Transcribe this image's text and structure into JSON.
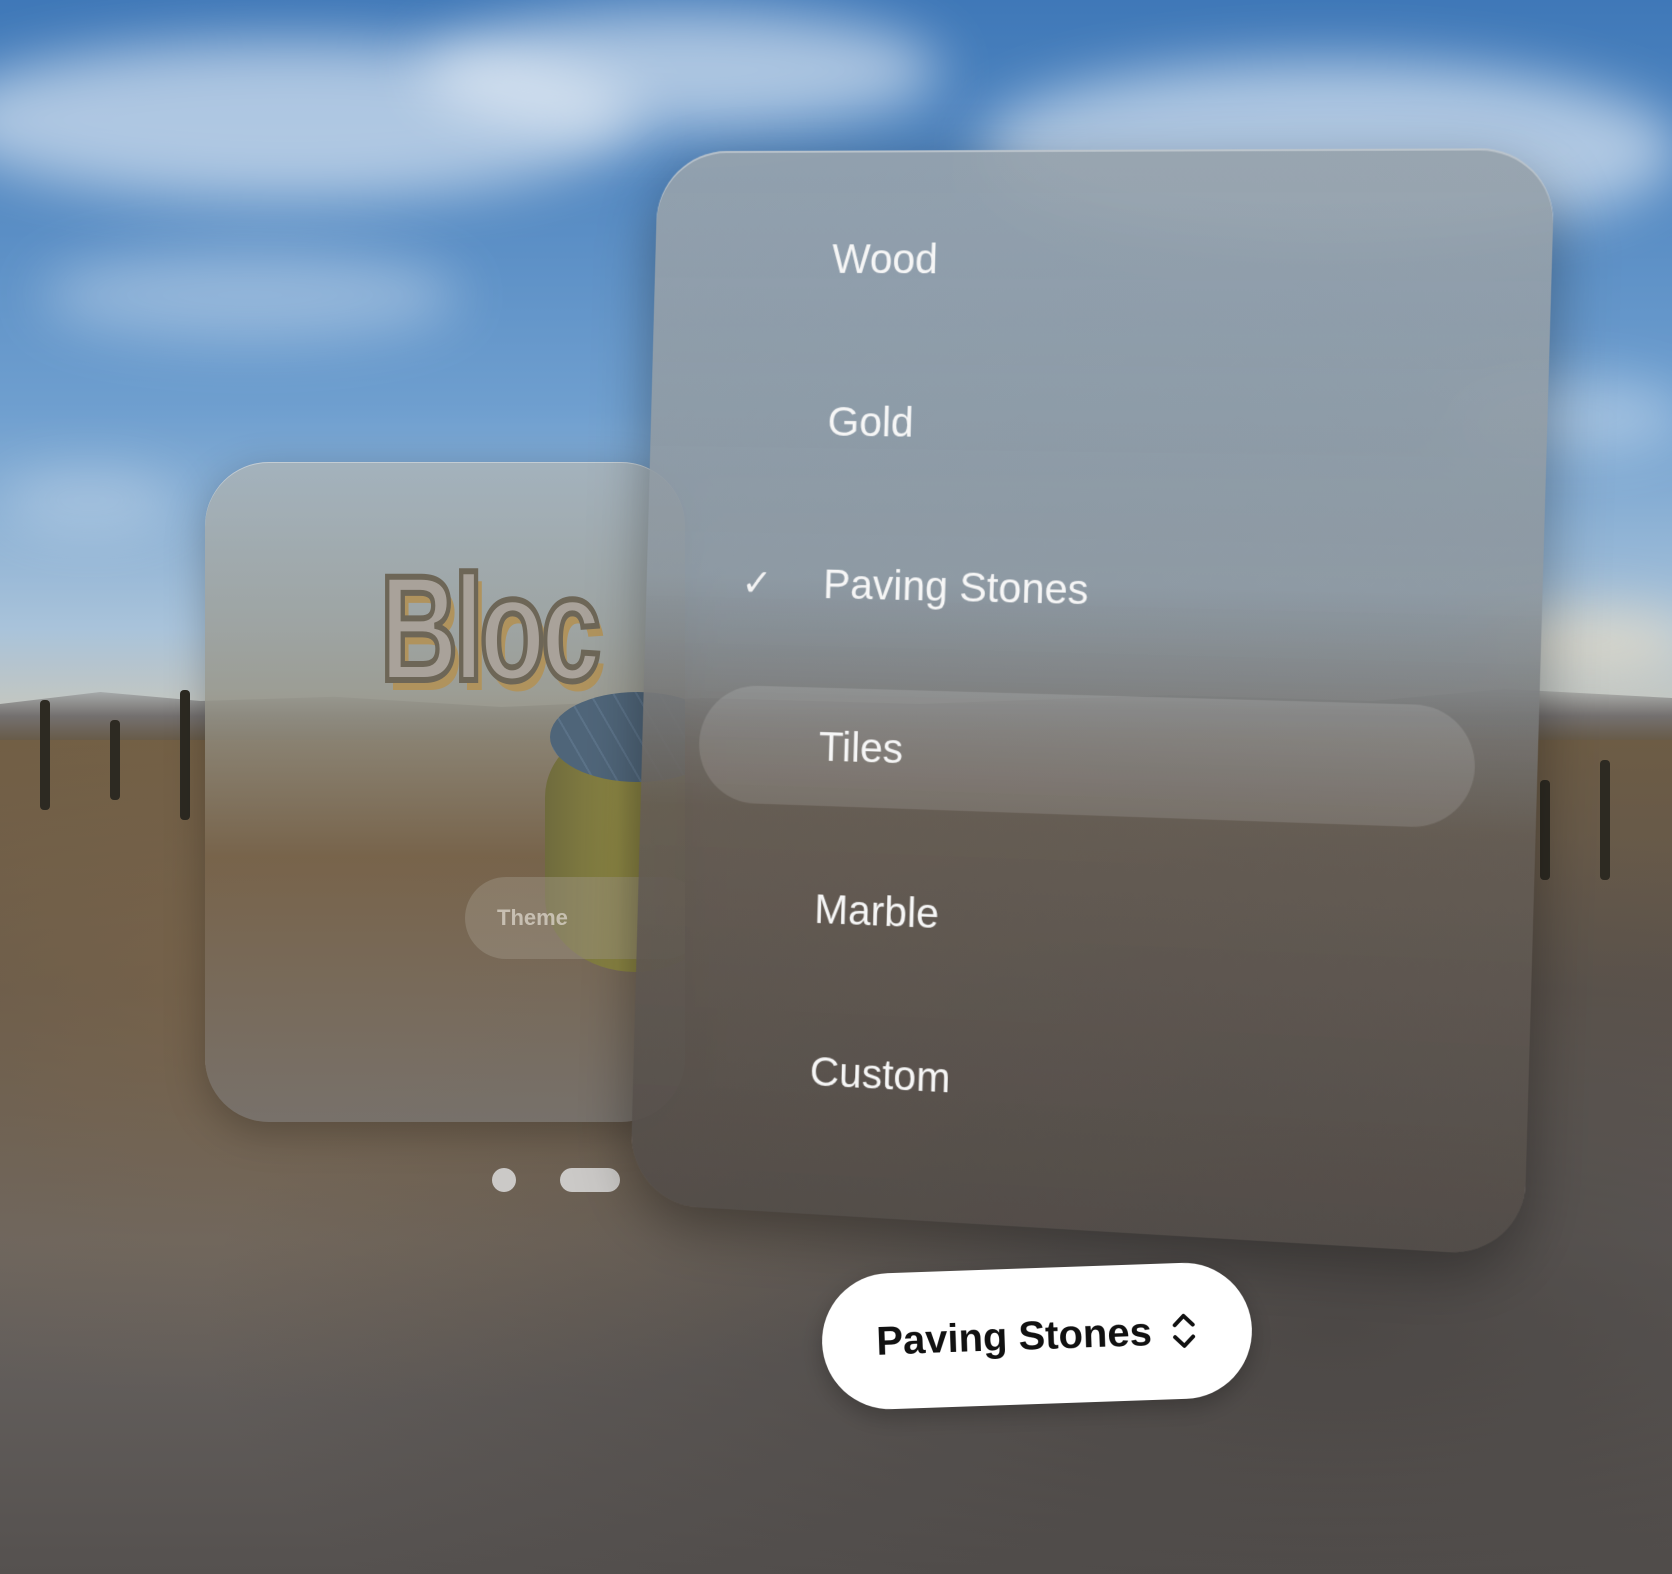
{
  "back_window": {
    "title_fragment": "Bloc",
    "theme_label": "Theme"
  },
  "menu": {
    "items": [
      {
        "label": "Wood",
        "selected": false
      },
      {
        "label": "Gold",
        "selected": false
      },
      {
        "label": "Paving Stones",
        "selected": true,
        "check": "✓"
      },
      {
        "label": "Tiles",
        "selected": false,
        "highlighted": true
      },
      {
        "label": "Marble",
        "selected": false
      },
      {
        "label": "Custom",
        "selected": false
      }
    ]
  },
  "dropdown": {
    "value": "Paving Stones",
    "icon": "chevron-up-down-icon"
  },
  "page_indicator": {
    "count": 2,
    "active_index": 1
  }
}
